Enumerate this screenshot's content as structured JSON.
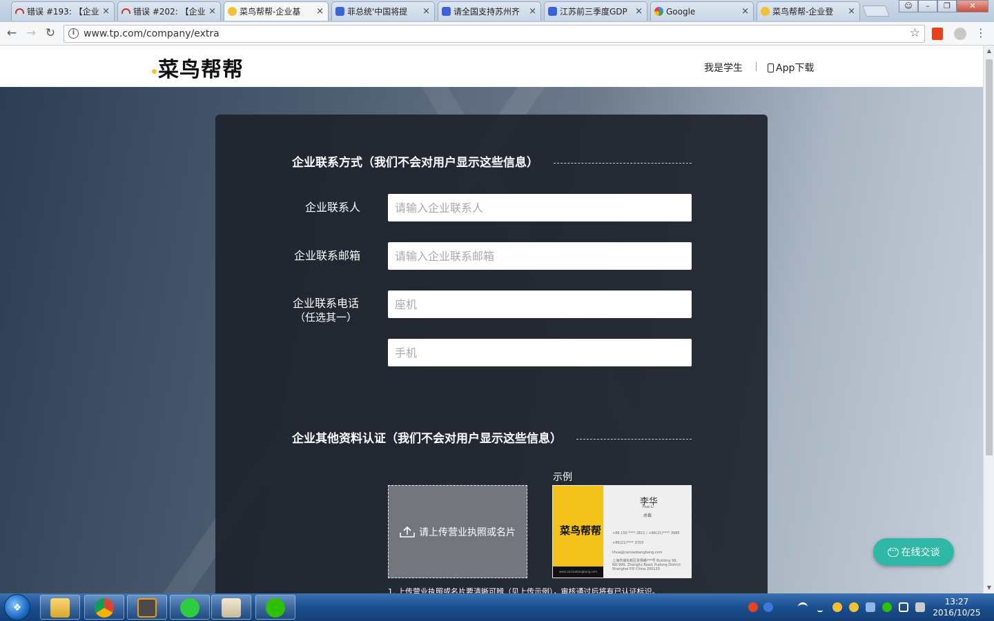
{
  "browser": {
    "tabs": [
      {
        "title": "错误 #193: 【企业",
        "favicon": "red-arc-icon",
        "active": false
      },
      {
        "title": "错误 #202: 【企业",
        "favicon": "red-arc-icon",
        "active": false
      },
      {
        "title": "菜鸟帮帮-企业基",
        "favicon": "bee-icon",
        "active": true
      },
      {
        "title": "菲总统'中国将提",
        "favicon": "baidu-paw-icon",
        "active": false
      },
      {
        "title": "请全国支持苏州齐",
        "favicon": "baidu-paw-icon",
        "active": false
      },
      {
        "title": "江苏前三季度GDP",
        "favicon": "baidu-paw-icon",
        "active": false
      },
      {
        "title": "Google",
        "favicon": "google-icon",
        "active": false
      },
      {
        "title": "菜鸟帮帮-企业登",
        "favicon": "bee-icon",
        "active": false
      }
    ],
    "close_glyph": "×",
    "url": "www.tp.com/company/extra"
  },
  "site": {
    "logo_text": "菜鸟帮帮",
    "nav_student": "我是学生",
    "nav_app": "App下载",
    "accent": "#f1c232"
  },
  "form": {
    "section1_title": "企业联系方式（我们不会对用户显示这些信息）",
    "contact_person_label": "企业联系人",
    "contact_person_placeholder": "请输入企业联系人",
    "contact_email_label": "企业联系邮箱",
    "contact_email_placeholder": "请输入企业联系邮箱",
    "contact_phone_label": "企业联系电话",
    "contact_phone_label_sub": "（任选其一）",
    "landline_placeholder": "座机",
    "mobile_placeholder": "手机",
    "section2_title": "企业其他资料认证（我们不会对用户显示这些信息）",
    "upload_label": "请上传营业执照或名片",
    "example_label": "示例",
    "note": "1. 上传营业执照或名片要清晰可辨（见上传示例），审核通过后将有已认证标识。"
  },
  "example_card": {
    "brand": "菜鸟帮帮",
    "name": "李华",
    "name_en": "Hua Li",
    "title": "总裁",
    "phone": "+86 150 **** 2811 / +86(21)**** 3985",
    "fax": "+86(21)**** 3703",
    "email": "lihua@cainiaobangbang.com",
    "address": "上海市浦东新区张杨路***号 Building 99, NO.999, Zhangliu Road, Pudong District Shanghai P.R China 200120",
    "website": "www.cainiaobangbang.com"
  },
  "chat": {
    "label": "在线交谈",
    "color": "#2fb8a6"
  },
  "taskbar": {
    "time": "13:27",
    "date": "2016/10/25"
  }
}
